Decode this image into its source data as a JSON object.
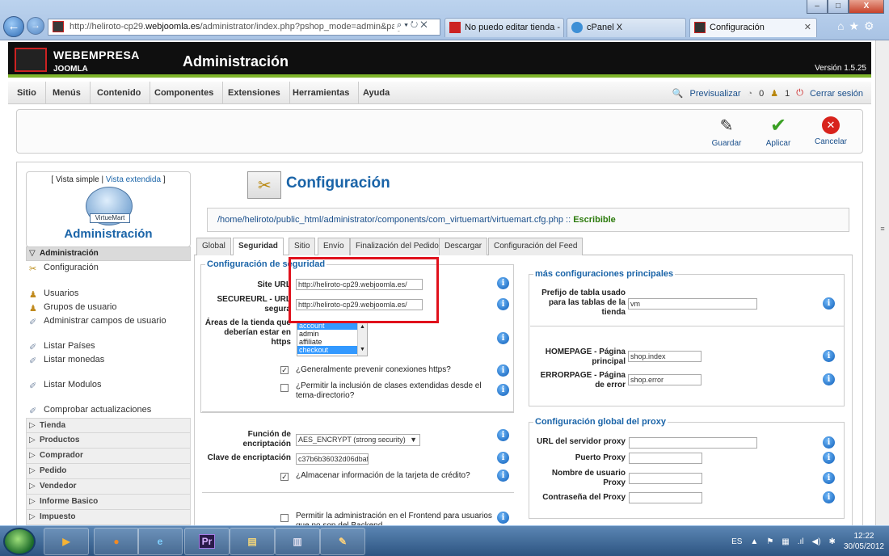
{
  "browser": {
    "address": "http://heliroto-cp29.",
    "address_domain": "webjoomla.es",
    "address_rest": "/administrator/index.php?pshop_mode=admin&page",
    "tabs": [
      {
        "label": "No puedo editar tienda - ..."
      },
      {
        "label": "cPanel X"
      },
      {
        "label": "Configuración"
      }
    ],
    "window_buttons": [
      "–",
      "□",
      "X"
    ],
    "nav_right_icons": [
      "home-icon",
      "star-icon",
      "gear-icon"
    ]
  },
  "header": {
    "brand_top": "WEBEMPRESA",
    "brand_sub": "JOOMLA",
    "title": "Administración",
    "version": "Versión 1.5.25"
  },
  "menu": {
    "items": [
      "Sitio",
      "Menús",
      "Contenido",
      "Componentes",
      "Extensiones",
      "Herramientas",
      "Ayuda"
    ],
    "status": {
      "preview": "Previsualizar",
      "count_a": "0",
      "count_b": "1",
      "logout": "Cerrar sesión"
    }
  },
  "toolbar": {
    "save": "Guardar",
    "apply": "Aplicar",
    "cancel": "Cancelar"
  },
  "sidebar": {
    "view_simple": "[ Vista simple | ",
    "view_extended": "Vista extendida",
    "view_end": " ]",
    "logo_text": "VirtueMart",
    "admin_title": "Administración",
    "section_admin": "Administración",
    "items": [
      "Configuración",
      "Usuarios",
      "Grupos de usuario",
      "Administrar campos de usuario",
      "Listar Países",
      "Listar monedas",
      "Listar Modulos",
      "Comprobar actualizaciones"
    ],
    "sections": [
      "Tienda",
      "Productos",
      "Comprador",
      "Pedido",
      "Vendedor",
      "Informe Basico",
      "Impuesto"
    ]
  },
  "config": {
    "title": "Configuración",
    "path": "/home/heliroto/public_html/administrator/components/com_virtuemart/virtuemart.cfg.php :: ",
    "path_status": "Escribible",
    "tabs": [
      "Global",
      "Seguridad",
      "Sitio",
      "Envío",
      "Finalización del Pedido",
      "Descargar",
      "Configuración del Feed"
    ],
    "active_tab": "Seguridad",
    "security_legend": "Configuración de seguridad",
    "site_url_label": "Site URL",
    "site_url_value": "http://heliroto-cp29.webjoomla.es/",
    "secure_url_label": "SECUREURL - URL segura",
    "secure_url_value": "http://heliroto-cp29.webjoomla.es/",
    "https_areas_label": "Áreas de la tienda que deberían estar en https",
    "https_areas_options": [
      "account",
      "admin",
      "affiliate",
      "checkout"
    ],
    "prevent_https_label": "¿Generalmente prevenir conexiones https?",
    "extended_classes_label": "¿Permitir la inclusión de clases extendidas desde el tema-directorio?",
    "encrypt_func_label": "Función de encriptación",
    "encrypt_func_value": "AES_ENCRYPT (strong security)",
    "encrypt_key_label": "Clave de encriptación",
    "encrypt_key_value": "c37b6b36032d06dbaf",
    "store_cc_label": "¿Almacenar información de la tarjeta de crédito?",
    "frontend_admin_label": "Permitir la administración en el Frontend para usuarios que no son del Backend",
    "more_legend": "más configuraciones principales",
    "table_prefix_label": "Prefijo de tabla usado para las tablas de la tienda",
    "table_prefix_value": "vm",
    "homepage_label": "HOMEPAGE - Página principal",
    "homepage_value": "shop.index",
    "errorpage_label": "ERRORPAGE - Página de error",
    "errorpage_value": "shop.error",
    "proxy_legend": "Configuración global del proxy",
    "proxy_url_label": "URL del servidor proxy",
    "proxy_port_label": "Puerto Proxy",
    "proxy_user_label": "Nombre de usuario Proxy",
    "proxy_pass_label": "Contraseña del Proxy"
  },
  "taskbar": {
    "lang": "ES",
    "time": "12:22",
    "date": "30/05/2012",
    "apps": [
      "media-player-icon",
      "firefox-icon",
      "ie-icon",
      "premiere-icon",
      "explorer-icon",
      "notepad-icon",
      "paint-icon"
    ],
    "app_labels": {
      "premiere": "Pr"
    }
  },
  "colors": {
    "accent": "#1a64a8",
    "highlight": "#e0111c",
    "joomla_green": "#7fb52b"
  }
}
